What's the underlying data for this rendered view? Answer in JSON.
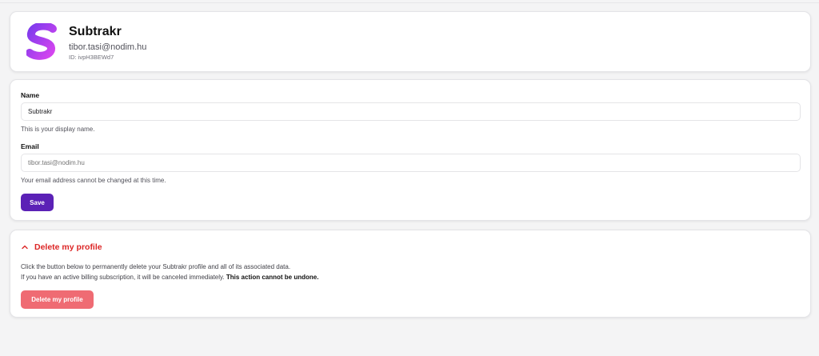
{
  "profile": {
    "app_name": "Subtrakr",
    "email": "tibor.tasi@nodim.hu",
    "id_text": "ID: ivpH3BEWd7",
    "logo_letter": "S",
    "logo_colors": [
      "#7c3aed",
      "#d946ef"
    ]
  },
  "form": {
    "name_label": "Name",
    "name_value": "Subtrakr",
    "name_help": "This is your display name.",
    "email_label": "Email",
    "email_placeholder": "tibor.tasi@nodim.hu",
    "email_help": "Your email address cannot be changed at this time.",
    "save_label": "Save"
  },
  "danger": {
    "title": "Delete my profile",
    "line1": "Click the button below to permanently delete your Subtrakr profile and all of its associated data.",
    "line2_prefix": "If you have an active billing subscription, it will be canceled immediately.",
    "line2_bold": "This action cannot be undone.",
    "delete_label": "Delete my profile",
    "accent_color": "#dc2626"
  },
  "colors": {
    "primary": "#5b21b6",
    "danger_button": "#ef6b73",
    "background": "#f4f4f5"
  }
}
